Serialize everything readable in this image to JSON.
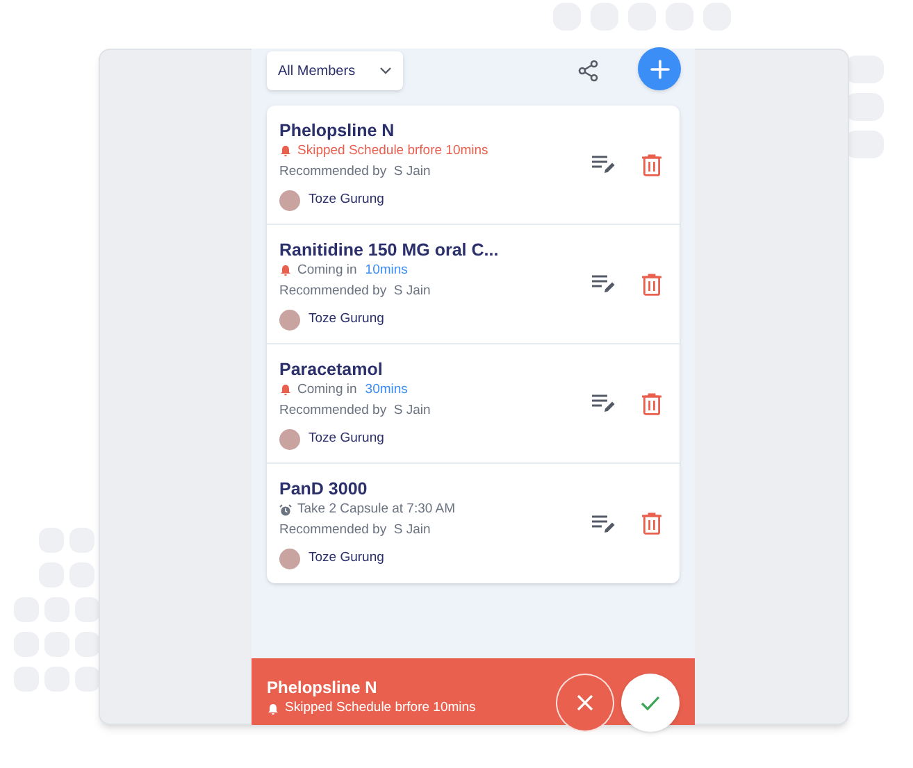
{
  "filter": {
    "label": "All Members"
  },
  "medicines": [
    {
      "name": "Phelopsline N",
      "status": {
        "kind": "alert",
        "text": "Skipped Schedule brfore 10mins"
      },
      "recommended": "Recommended by  S Jain",
      "member": "Toze Gurung"
    },
    {
      "name": "Ranitidine 150 MG oral C...",
      "status": {
        "kind": "upcoming",
        "text": "Coming in",
        "highlight": "10mins"
      },
      "recommended": "Recommended by  S Jain",
      "member": "Toze Gurung"
    },
    {
      "name": "Paracetamol",
      "status": {
        "kind": "upcoming",
        "text": "Coming in",
        "highlight": "30mins"
      },
      "recommended": "Recommended by  S Jain",
      "member": "Toze Gurung"
    },
    {
      "name": "PanD 3000",
      "status": {
        "kind": "schedule",
        "text": "Take 2 Capsule at 7:30 AM"
      },
      "recommended": "Recommended by  S Jain",
      "member": "Toze Gurung"
    }
  ],
  "alert_banner": {
    "title": "Phelopsline N",
    "status": {
      "kind": "alert",
      "text": "Skipped Schedule brfore 10mins"
    }
  }
}
